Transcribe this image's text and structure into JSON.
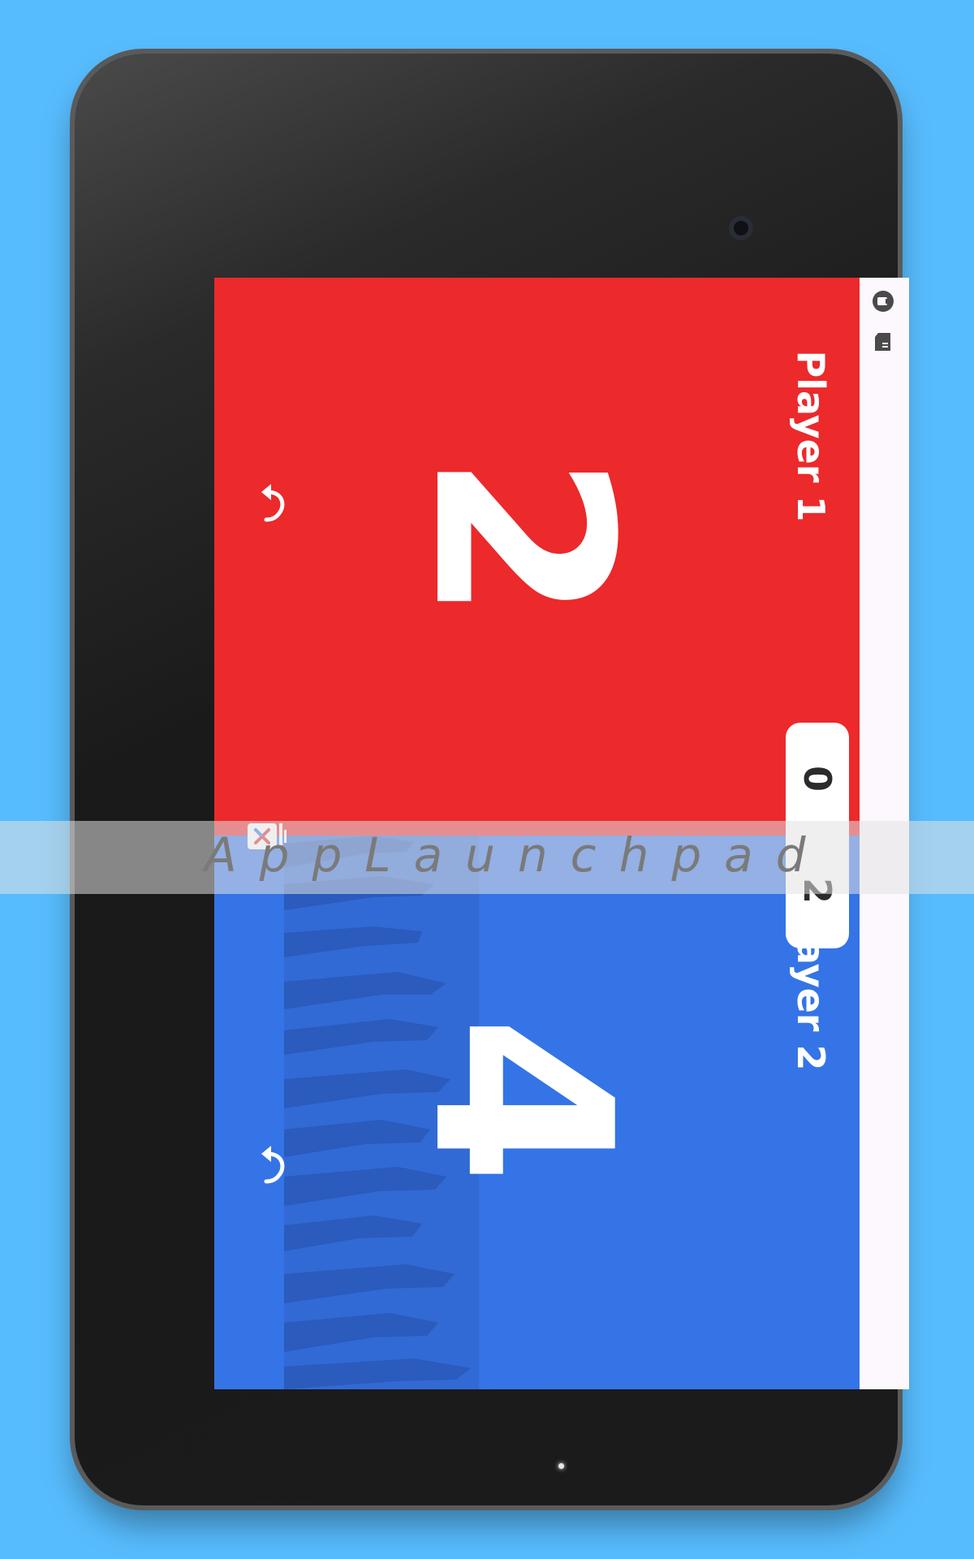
{
  "device": {
    "frame": "tablet",
    "camera_icon": "camera-lens",
    "home_indicator_icon": "led-dot"
  },
  "status_bar": {
    "icons": [
      "data-saver-icon",
      "sd-card-icon"
    ]
  },
  "players": [
    {
      "label": "Player 1",
      "score": "2",
      "color": "#ec292b",
      "undo_icon": "undo-icon"
    },
    {
      "label": "Player 2",
      "score": "4",
      "color": "#3574e6",
      "undo_icon": "undo-icon"
    }
  ],
  "tally": {
    "top": "0",
    "bottom": "2"
  },
  "ad": {
    "close_icon": "ad-close-icon"
  },
  "watermark": {
    "text": "AppLaunchpad"
  },
  "colors": {
    "background": "#57bcfd",
    "status_bar": "#fdf8fd",
    "red": "#ec292b",
    "blue": "#3574e6"
  }
}
